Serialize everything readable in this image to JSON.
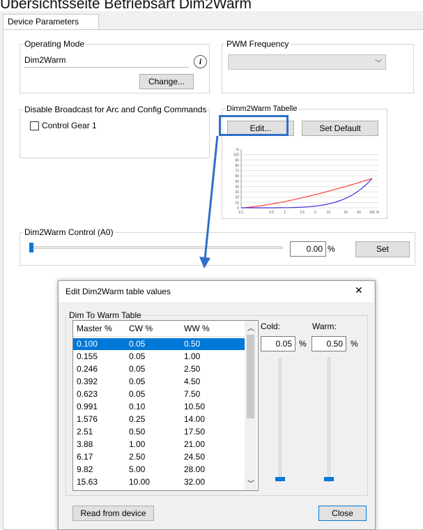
{
  "heading": "Übersichtsseite Betriebsart Dim2Warm",
  "tab": {
    "label": "Device Parameters"
  },
  "operating_mode": {
    "legend": "Operating Mode",
    "value": "Dim2Warm",
    "info_icon": "info-icon",
    "change_label": "Change..."
  },
  "pwm": {
    "legend": "PWM Frequency",
    "value": ""
  },
  "broadcast": {
    "legend": "Disable Broadcast for Arc and Config Commands",
    "checkbox_label": "Control Gear 1",
    "checked": false
  },
  "tabelle": {
    "legend": "Dimm2Warm Tabelle",
    "edit_label": "Edit...",
    "default_label": "Set Default",
    "y_ticks": [
      "%",
      "100",
      "90",
      "80",
      "70",
      "60",
      "50",
      "40",
      "30",
      "20",
      "10",
      "0"
    ],
    "x_ticks": [
      "0.1",
      "0.5",
      "1",
      "2.5",
      "5",
      "10",
      "25",
      "50",
      "100",
      "%"
    ],
    "red_color": "#ff3b3b",
    "blue_color": "#3a2fd6"
  },
  "control": {
    "legend": "Dim2Warm Control (A0)",
    "value": "0.00",
    "unit": "%",
    "set_label": "Set",
    "level": 0
  },
  "annotation": {
    "color": "#2f6fc7"
  },
  "dialog": {
    "title": "Edit Dim2Warm table values",
    "close_glyph": "✕",
    "group_legend": "Dim To Warm Table",
    "columns": [
      "Master %",
      "CW %",
      "WW %"
    ],
    "rows": [
      [
        "0.100",
        "0.05",
        "0.50"
      ],
      [
        "0.155",
        "0.05",
        "1.00"
      ],
      [
        "0.246",
        "0.05",
        "2.50"
      ],
      [
        "0.392",
        "0.05",
        "4.50"
      ],
      [
        "0.623",
        "0.05",
        "7.50"
      ],
      [
        "0.991",
        "0.10",
        "10.50"
      ],
      [
        "1.576",
        "0.25",
        "14.00"
      ],
      [
        "2.51",
        "0.50",
        "17.50"
      ],
      [
        "3.88",
        "1.00",
        "21.00"
      ],
      [
        "6.17",
        "2.50",
        "24.50"
      ],
      [
        "9.82",
        "5.00",
        "28.00"
      ],
      [
        "15.63",
        "10.00",
        "32.00"
      ]
    ],
    "cold_label": "Cold:",
    "cold_value": "0.05",
    "warm_label": "Warm:",
    "warm_value": "0.50",
    "percent": "%",
    "cold_level": 0.0005,
    "warm_level": 0.005,
    "read_label": "Read from device",
    "close_label": "Close"
  }
}
